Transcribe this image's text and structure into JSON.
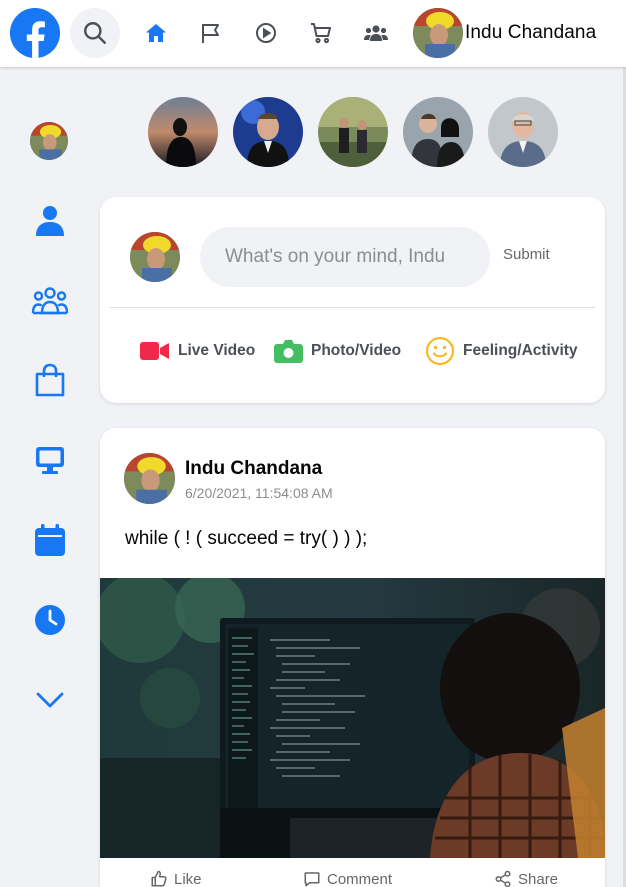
{
  "header": {
    "logo_icon": "facebook-logo-icon",
    "search_icon": "search-icon",
    "nav_icons": [
      "home-icon",
      "flag-icon",
      "play-circle-icon",
      "cart-icon",
      "users-icon"
    ],
    "user_name": "Indu Chandana"
  },
  "sidebar": {
    "icons": [
      "user-icon",
      "users-group-icon",
      "shopping-bag-icon",
      "monitor-icon",
      "calendar-icon",
      "clock-icon",
      "chevron-down-icon"
    ]
  },
  "composer": {
    "placeholder": "What's on your mind, Indu",
    "submit_label": "Submit",
    "actions": [
      {
        "label": "Live Video",
        "icon": "video-camera-icon",
        "color": "#f02849"
      },
      {
        "label": "Photo/Video",
        "icon": "camera-icon",
        "color": "#45bd62"
      },
      {
        "label": "Feeling/Activity",
        "icon": "smiley-icon",
        "color": "#f7b928"
      }
    ]
  },
  "post": {
    "author": "Indu Chandana",
    "timestamp": "6/20/2021, 11:54:08 AM",
    "text": "while ( ! ( succeed = try( ) ) );",
    "actions": [
      {
        "label": "Like",
        "icon": "thumbs-up-icon"
      },
      {
        "label": "Comment",
        "icon": "comment-icon"
      },
      {
        "label": "Share",
        "icon": "share-icon"
      }
    ]
  },
  "colors": {
    "accent": "#1877f2",
    "sidebar_icon": "#1877f2",
    "background": "#f0f2f5"
  }
}
